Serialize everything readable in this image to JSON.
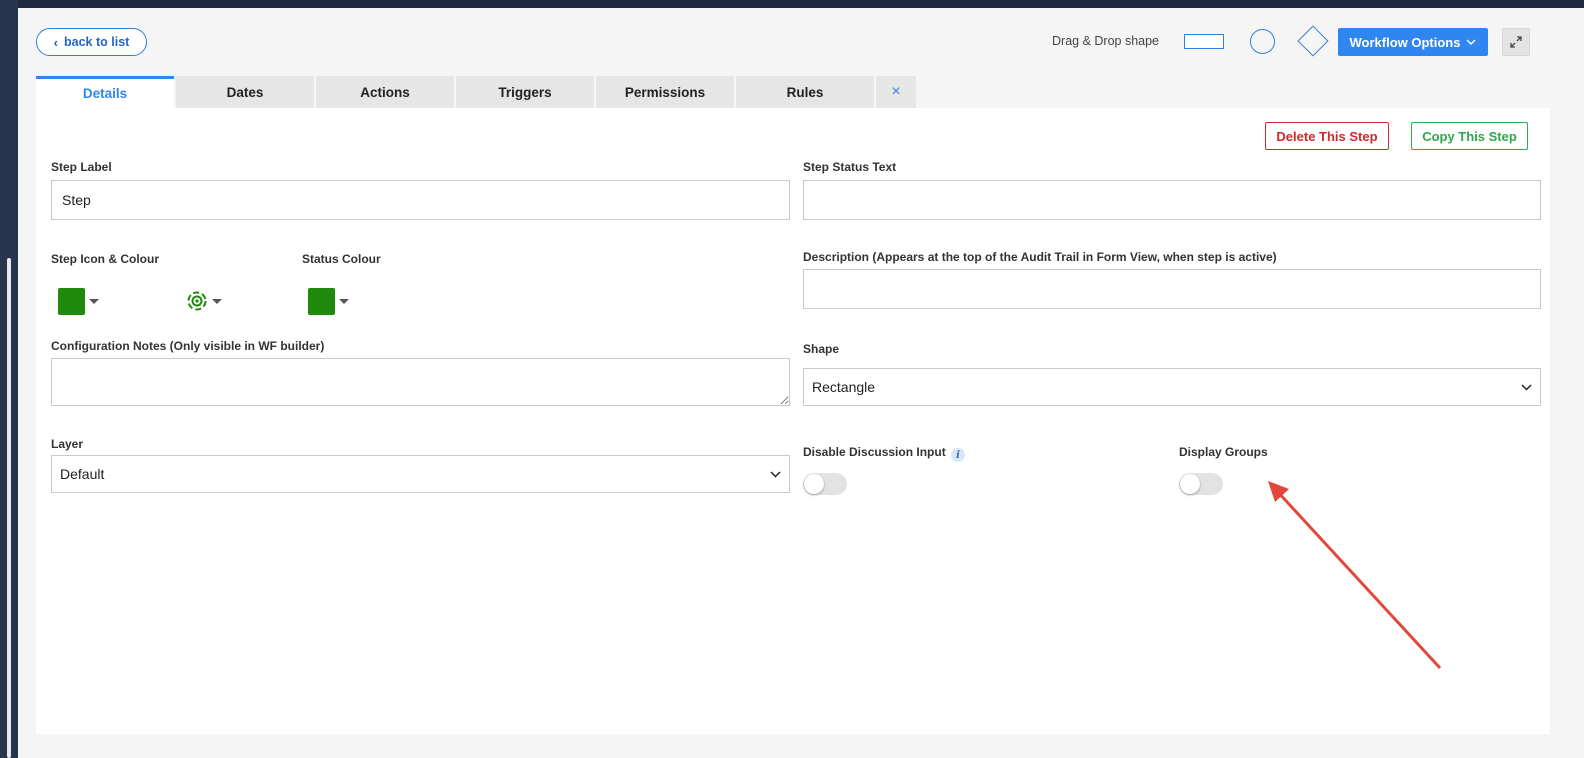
{
  "toolbar": {
    "back_label": "back to list",
    "dnd_label": "Drag & Drop shape",
    "shapes": [
      "rectangle",
      "circle",
      "diamond"
    ],
    "workflow_options_label": "Workflow Options",
    "expand_icon": "expand-icon"
  },
  "tabs": [
    {
      "label": "Details",
      "active": true
    },
    {
      "label": "Dates",
      "active": false
    },
    {
      "label": "Actions",
      "active": false
    },
    {
      "label": "Triggers",
      "active": false
    },
    {
      "label": "Permissions",
      "active": false
    },
    {
      "label": "Rules",
      "active": false
    }
  ],
  "tab_close_glyph": "×",
  "actions": {
    "delete_label": "Delete This Step",
    "copy_label": "Copy This Step"
  },
  "form": {
    "step_label": {
      "label": "Step Label",
      "value": "Step"
    },
    "step_status_text": {
      "label": "Step Status Text",
      "value": ""
    },
    "step_icon_colour": {
      "label": "Step Icon & Colour",
      "colour": "#1f8a0b",
      "icon": "gear-cycle-icon"
    },
    "status_colour": {
      "label": "Status Colour",
      "colour": "#1f8a0b"
    },
    "description": {
      "label": "Description (Appears at the top of the Audit Trail in Form View, when step is active)",
      "value": ""
    },
    "config_notes": {
      "label": "Configuration Notes (Only visible in WF builder)",
      "value": ""
    },
    "shape": {
      "label": "Shape",
      "value": "Rectangle"
    },
    "layer": {
      "label": "Layer",
      "value": "Default"
    },
    "disable_discussion": {
      "label": "Disable Discussion Input",
      "on": false,
      "info_glyph": "i"
    },
    "display_groups": {
      "label": "Display Groups",
      "on": false
    }
  },
  "colors": {
    "accent": "#2f86f0",
    "danger": "#d9262b",
    "success": "#2fa84b",
    "annotation_arrow": "#e2483a"
  }
}
